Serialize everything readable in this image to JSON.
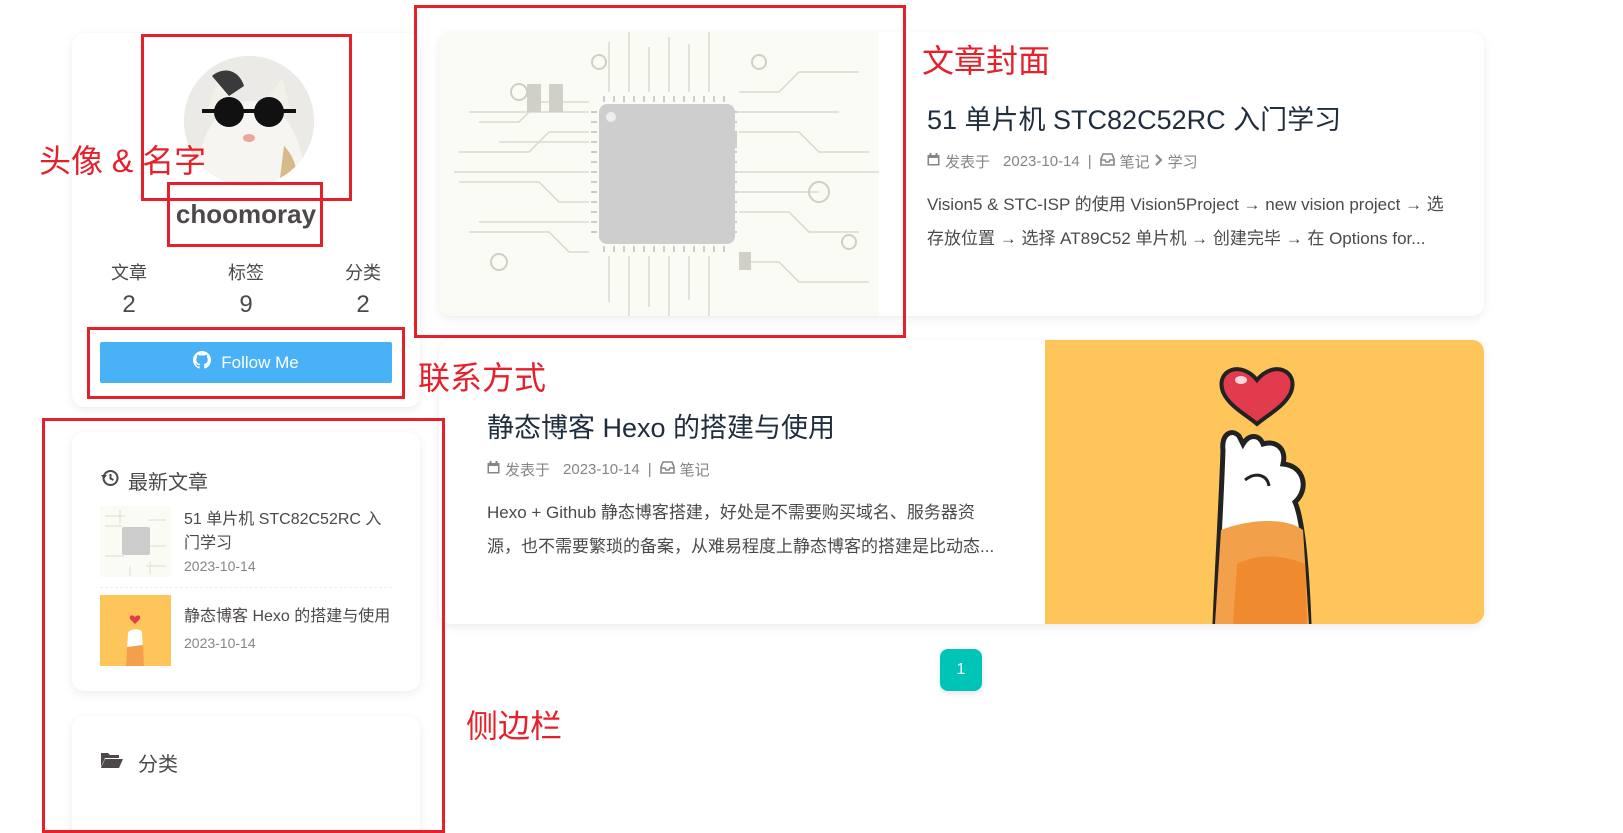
{
  "profile": {
    "name": "choomoray",
    "stats": [
      {
        "label": "文章",
        "value": "2"
      },
      {
        "label": "标签",
        "value": "9"
      },
      {
        "label": "分类",
        "value": "2"
      }
    ],
    "follow_label": "Follow Me",
    "follow_icon": "github-icon"
  },
  "recent": {
    "heading": "最新文章",
    "heading_icon": "history-icon",
    "items": [
      {
        "title": "51 单片机 STC82C52RC 入门学习",
        "date": "2023-10-14"
      },
      {
        "title": "静态博客 Hexo 的搭建与使用",
        "date": "2023-10-14"
      }
    ]
  },
  "categories": {
    "heading": "分类",
    "heading_icon": "folder-open-icon"
  },
  "posts": [
    {
      "title": "51 单片机 STC82C52RC 入门学习",
      "meta_prefix": "发表于",
      "date": "2023-10-14",
      "category": "笔记",
      "subcategory": "学习",
      "excerpt": "Vision5 & STC-ISP 的使用 Vision5Project → new vision project → 选存放位置 → 选择 AT89C52 单片机 → 创建完毕 → 在 Options for..."
    },
    {
      "title": "静态博客 Hexo 的搭建与使用",
      "meta_prefix": "发表于",
      "date": "2023-10-14",
      "category": "笔记",
      "excerpt": "Hexo + Github 静态博客搭建，好处是不需要购买域名、服务器资源，也不需要繁琐的备案，从难易程度上静态博客的搭建是比动态..."
    }
  ],
  "pagination": {
    "current": "1"
  },
  "annotations": {
    "cover": "文章封面",
    "avatar": "头像 & 名字",
    "contact": "联系方式",
    "sidebar": "侧边栏"
  },
  "colors": {
    "accent_button": "#49b1f5",
    "pagination": "#00c4b6",
    "annotation": "#e5202a",
    "cover2_bg": "#fdc55a"
  }
}
